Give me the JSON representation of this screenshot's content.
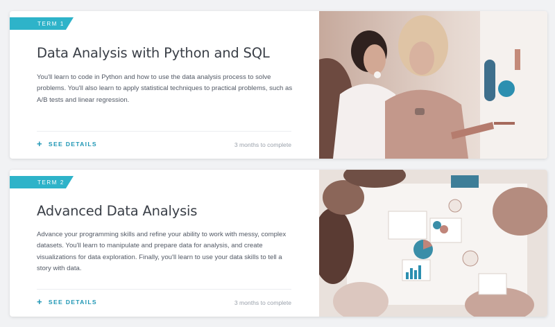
{
  "terms": [
    {
      "badge": "TERM 1",
      "title": "Data Analysis with Python and SQL",
      "description": "You'll learn to code in Python and how to use the data analysis process to solve problems. You'll also learn to apply statistical techniques to practical problems, such as A/B tests and linear regression.",
      "details_label": "SEE DETAILS",
      "duration": "3 months to complete",
      "image_icon": "people-at-whiteboard-photo"
    },
    {
      "badge": "TERM 2",
      "title": "Advanced Data Analysis",
      "description": "Advance your programming skills and refine your ability to work with messy, complex datasets. You'll learn to manipulate and prepare data for analysis, and create visualizations for data exploration. Finally, you'll learn to use your data skills to tell a story with data.",
      "details_label": "SEE DETAILS",
      "duration": "3 months to complete",
      "image_icon": "team-table-charts-photo"
    }
  ],
  "colors": {
    "accent": "#2eb3c9",
    "link": "#1e96b4",
    "title": "#3a3f47",
    "body_text": "#525965",
    "muted": "#9aa1ab",
    "background": "#f1f2f4"
  }
}
